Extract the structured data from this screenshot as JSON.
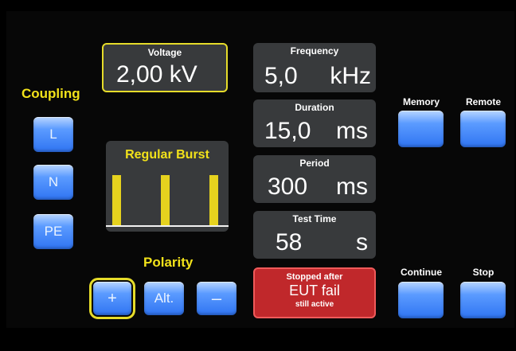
{
  "coupling": {
    "title": "Coupling",
    "buttons": [
      "L",
      "N",
      "PE"
    ]
  },
  "voltage": {
    "title": "Voltage",
    "value": "2,00 kV"
  },
  "waveform": {
    "title": "Regular Burst",
    "pulse_count": 3
  },
  "polarity": {
    "title": "Polarity",
    "buttons": {
      "plus": "+",
      "alt": "Alt.",
      "minus": "–"
    },
    "selected": "plus"
  },
  "frequency": {
    "title": "Frequency",
    "value": "5,0",
    "unit": "kHz"
  },
  "duration": {
    "title": "Duration",
    "value": "15,0",
    "unit": "ms"
  },
  "period": {
    "title": "Period",
    "value": "300",
    "unit": "ms"
  },
  "test_time": {
    "title": "Test Time",
    "value": "58",
    "unit": "s"
  },
  "status": {
    "line1": "Stopped after",
    "line2": "EUT fail",
    "line3": "still active"
  },
  "right": {
    "memory": "Memory",
    "remote": "Remote",
    "continue": "Continue",
    "stop": "Stop"
  },
  "colors": {
    "accent_yellow": "#f2e21a",
    "button_blue": "#3a80f5",
    "panel_gray": "#383a3c",
    "alert_red": "#c0282b"
  }
}
